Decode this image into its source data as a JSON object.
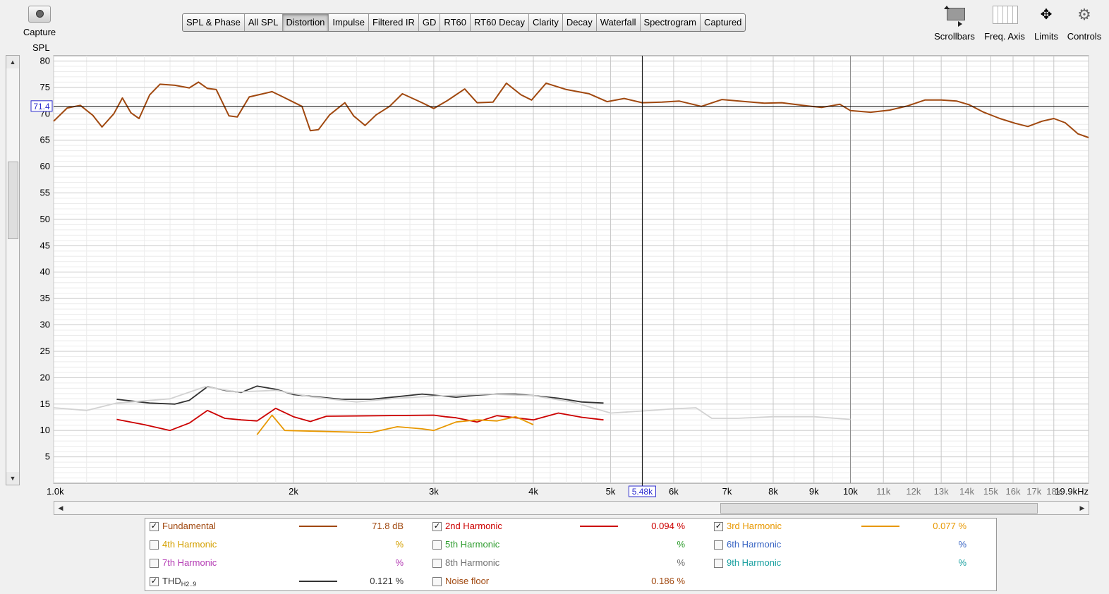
{
  "toolbar": {
    "capture_label": "Capture",
    "tabs": [
      "SPL & Phase",
      "All SPL",
      "Distortion",
      "Impulse",
      "Filtered IR",
      "GD",
      "RT60",
      "RT60 Decay",
      "Clarity",
      "Decay",
      "Waterfall",
      "Spectrogram",
      "Captured"
    ],
    "active_tab": "Distortion",
    "tools": [
      {
        "label": "Scrollbars",
        "icon": "scrollbars-icon"
      },
      {
        "label": "Freq. Axis",
        "icon": "freq-axis-icon"
      },
      {
        "label": "Limits",
        "icon": "limits-icon"
      },
      {
        "label": "Controls",
        "icon": "gear-icon"
      }
    ]
  },
  "chart_data": {
    "type": "line",
    "ylabel": "SPL",
    "xscale": "log",
    "xlim": [
      1000,
      19900
    ],
    "ylim": [
      0,
      81
    ],
    "yticks": [
      5,
      10,
      15,
      20,
      25,
      30,
      35,
      40,
      45,
      50,
      55,
      60,
      65,
      70,
      75,
      80
    ],
    "xticks": [
      {
        "f": 1000,
        "label": "1.0k"
      },
      {
        "f": 2000,
        "label": "2k"
      },
      {
        "f": 3000,
        "label": "3k"
      },
      {
        "f": 4000,
        "label": "4k"
      },
      {
        "f": 5000,
        "label": "5k"
      },
      {
        "f": 6000,
        "label": "6k"
      },
      {
        "f": 7000,
        "label": "7k"
      },
      {
        "f": 8000,
        "label": "8k"
      },
      {
        "f": 9000,
        "label": "9k"
      },
      {
        "f": 10000,
        "label": "10k"
      },
      {
        "f": 11000,
        "label": "11k"
      },
      {
        "f": 12000,
        "label": "12k"
      },
      {
        "f": 13000,
        "label": "13k"
      },
      {
        "f": 14000,
        "label": "14k"
      },
      {
        "f": 15000,
        "label": "15k"
      },
      {
        "f": 16000,
        "label": "16k"
      },
      {
        "f": 17000,
        "label": "17k"
      },
      {
        "f": 18000,
        "label": "18k"
      },
      {
        "f": 19900,
        "label": "19.9kHz"
      }
    ],
    "cursor": {
      "y_value": 71.4,
      "y_label": "71.4",
      "x_value": 5480,
      "x_label": "5.48k"
    },
    "grid": true,
    "series": [
      {
        "name": "Fundamental",
        "color": "#a0480f",
        "points": [
          [
            1000,
            68.6
          ],
          [
            1040,
            71.1
          ],
          [
            1080,
            71.6
          ],
          [
            1120,
            69.7
          ],
          [
            1150,
            67.5
          ],
          [
            1190,
            70.0
          ],
          [
            1220,
            73.0
          ],
          [
            1250,
            70.2
          ],
          [
            1280,
            69.1
          ],
          [
            1320,
            73.6
          ],
          [
            1360,
            75.6
          ],
          [
            1420,
            75.4
          ],
          [
            1480,
            74.9
          ],
          [
            1520,
            76.0
          ],
          [
            1560,
            74.8
          ],
          [
            1600,
            74.6
          ],
          [
            1660,
            69.6
          ],
          [
            1700,
            69.4
          ],
          [
            1760,
            73.2
          ],
          [
            1820,
            73.7
          ],
          [
            1880,
            74.2
          ],
          [
            1940,
            73.2
          ],
          [
            2000,
            72.2
          ],
          [
            2050,
            71.4
          ],
          [
            2100,
            66.8
          ],
          [
            2150,
            67.0
          ],
          [
            2220,
            69.8
          ],
          [
            2320,
            72.1
          ],
          [
            2380,
            69.6
          ],
          [
            2460,
            67.8
          ],
          [
            2540,
            69.8
          ],
          [
            2640,
            71.4
          ],
          [
            2740,
            73.8
          ],
          [
            2900,
            72.1
          ],
          [
            3000,
            71.0
          ],
          [
            3120,
            72.5
          ],
          [
            3280,
            74.7
          ],
          [
            3400,
            72.1
          ],
          [
            3560,
            72.2
          ],
          [
            3700,
            75.8
          ],
          [
            3860,
            73.6
          ],
          [
            3980,
            72.6
          ],
          [
            4150,
            75.8
          ],
          [
            4400,
            74.6
          ],
          [
            4700,
            73.8
          ],
          [
            4950,
            72.3
          ],
          [
            5200,
            72.9
          ],
          [
            5480,
            72.1
          ],
          [
            5800,
            72.2
          ],
          [
            6100,
            72.4
          ],
          [
            6500,
            71.4
          ],
          [
            6900,
            72.7
          ],
          [
            7400,
            72.3
          ],
          [
            7800,
            72.0
          ],
          [
            8200,
            72.1
          ],
          [
            8700,
            71.6
          ],
          [
            9200,
            71.2
          ],
          [
            9700,
            71.8
          ],
          [
            10000,
            70.6
          ],
          [
            10600,
            70.3
          ],
          [
            11200,
            70.7
          ],
          [
            11800,
            71.5
          ],
          [
            12400,
            72.6
          ],
          [
            13000,
            72.6
          ],
          [
            13600,
            72.4
          ],
          [
            14100,
            71.7
          ],
          [
            14700,
            70.3
          ],
          [
            15400,
            69.1
          ],
          [
            16100,
            68.2
          ],
          [
            16700,
            67.6
          ],
          [
            17400,
            68.6
          ],
          [
            18000,
            69.1
          ],
          [
            18600,
            68.3
          ],
          [
            19300,
            66.2
          ],
          [
            19900,
            65.5
          ]
        ]
      },
      {
        "name": "THD",
        "color": "#333333",
        "points": [
          [
            1200,
            15.9
          ],
          [
            1320,
            15.2
          ],
          [
            1420,
            15.0
          ],
          [
            1480,
            15.7
          ],
          [
            1560,
            18.3
          ],
          [
            1640,
            17.6
          ],
          [
            1720,
            17.2
          ],
          [
            1800,
            18.4
          ],
          [
            1900,
            17.8
          ],
          [
            2000,
            16.8
          ],
          [
            2100,
            16.5
          ],
          [
            2300,
            15.9
          ],
          [
            2500,
            15.9
          ],
          [
            2700,
            16.4
          ],
          [
            2900,
            16.9
          ],
          [
            3000,
            16.7
          ],
          [
            3200,
            16.3
          ],
          [
            3400,
            16.7
          ],
          [
            3600,
            16.9
          ],
          [
            3800,
            16.9
          ],
          [
            4000,
            16.6
          ],
          [
            4300,
            16.1
          ],
          [
            4600,
            15.4
          ],
          [
            4900,
            15.2
          ]
        ]
      },
      {
        "name": "2nd Harmonic",
        "color": "#cc0000",
        "points": [
          [
            1200,
            12.1
          ],
          [
            1300,
            11.1
          ],
          [
            1400,
            10.0
          ],
          [
            1480,
            11.4
          ],
          [
            1560,
            13.8
          ],
          [
            1640,
            12.3
          ],
          [
            1720,
            12.0
          ],
          [
            1800,
            11.8
          ],
          [
            1900,
            14.2
          ],
          [
            2000,
            12.6
          ],
          [
            2100,
            11.7
          ],
          [
            2200,
            12.7
          ],
          [
            3000,
            12.9
          ],
          [
            3100,
            12.6
          ],
          [
            3200,
            12.4
          ],
          [
            3400,
            11.6
          ],
          [
            3600,
            12.8
          ],
          [
            3800,
            12.4
          ],
          [
            4000,
            12.0
          ],
          [
            4300,
            13.3
          ],
          [
            4600,
            12.5
          ],
          [
            4900,
            12.0
          ]
        ]
      },
      {
        "name": "3rd Harmonic",
        "color": "#e89800",
        "points": [
          [
            1800,
            9.2
          ],
          [
            1880,
            12.9
          ],
          [
            1950,
            10.0
          ],
          [
            2500,
            9.6
          ],
          [
            2700,
            10.7
          ],
          [
            2900,
            10.3
          ],
          [
            3000,
            10.0
          ],
          [
            3200,
            11.6
          ],
          [
            3400,
            12.0
          ],
          [
            3600,
            11.8
          ],
          [
            3800,
            12.6
          ],
          [
            4000,
            11.1
          ]
        ]
      },
      {
        "name": "Noise floor",
        "color": "#d2d2d2",
        "points": [
          [
            1000,
            14.3
          ],
          [
            1100,
            13.8
          ],
          [
            1200,
            15.2
          ],
          [
            1400,
            16.0
          ],
          [
            1550,
            18.3
          ],
          [
            1700,
            17.3
          ],
          [
            1900,
            17.6
          ],
          [
            2100,
            16.4
          ],
          [
            2400,
            15.4
          ],
          [
            2700,
            16.1
          ],
          [
            3000,
            16.5
          ],
          [
            3500,
            16.9
          ],
          [
            4000,
            16.6
          ],
          [
            4500,
            15.3
          ],
          [
            5000,
            13.3
          ],
          [
            5500,
            13.7
          ],
          [
            6000,
            14.1
          ],
          [
            6400,
            14.3
          ],
          [
            6700,
            12.3
          ],
          [
            7200,
            12.3
          ],
          [
            8000,
            12.6
          ],
          [
            9000,
            12.6
          ],
          [
            10000,
            12.1
          ]
        ]
      }
    ]
  },
  "legend": [
    {
      "name": "Fundamental",
      "checked": true,
      "color": "#a0480f",
      "line": true,
      "value": "71.8 dB"
    },
    {
      "name": "2nd Harmonic",
      "checked": true,
      "color": "#cc0000",
      "line": true,
      "value": "0.094 %"
    },
    {
      "name": "3rd Harmonic",
      "checked": true,
      "color": "#e89800",
      "line": true,
      "value": "0.077 %"
    },
    {
      "name": "4th Harmonic",
      "checked": false,
      "color": "#d4a000",
      "line": false,
      "value": "%"
    },
    {
      "name": "5th Harmonic",
      "checked": false,
      "color": "#2e9c2e",
      "line": false,
      "value": "%"
    },
    {
      "name": "6th Harmonic",
      "checked": false,
      "color": "#3a66c4",
      "line": false,
      "value": "%"
    },
    {
      "name": "7th Harmonic",
      "checked": false,
      "color": "#b43cb4",
      "line": false,
      "value": "%"
    },
    {
      "name": "8th Harmonic",
      "checked": false,
      "color": "#707070",
      "line": false,
      "value": "%"
    },
    {
      "name": "9th Harmonic",
      "checked": false,
      "color": "#1aa0a0",
      "line": false,
      "value": "%"
    },
    {
      "name": "THD",
      "sub": "H2..9",
      "checked": true,
      "color": "#333333",
      "line": true,
      "value": "0.121 %"
    },
    {
      "name": "Noise floor",
      "checked": false,
      "color": "#a0480f",
      "line": false,
      "value": "0.186 %"
    }
  ]
}
